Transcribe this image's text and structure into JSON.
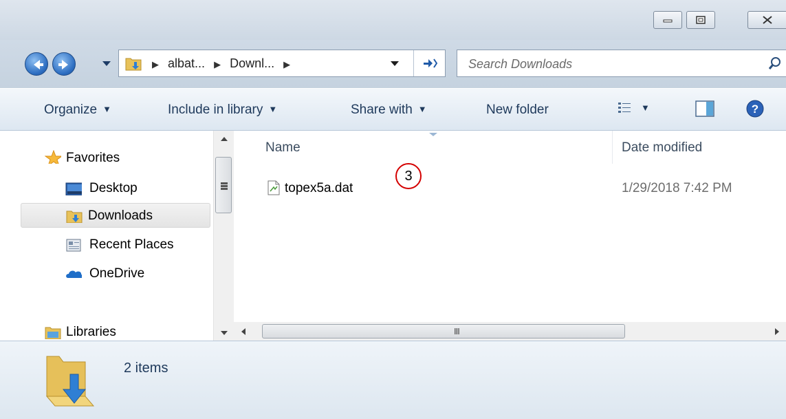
{
  "window": {
    "controls": {
      "minimize": "minimize",
      "maximize": "maximize",
      "close": "close"
    }
  },
  "address": {
    "breadcrumbs": [
      "albat...",
      "Downl..."
    ],
    "folder_icon": "downloads-folder-icon"
  },
  "search": {
    "placeholder": "Search Downloads",
    "value": ""
  },
  "toolbar": {
    "organize": "Organize",
    "include_in_library": "Include in library",
    "share_with": "Share with",
    "new_folder": "New folder",
    "views_icon": "view-options-icon",
    "preview_icon": "preview-pane-icon",
    "help_icon": "help-icon"
  },
  "nav": {
    "favorites": "Favorites",
    "items": [
      {
        "label": "Desktop",
        "icon": "desktop-icon"
      },
      {
        "label": "Downloads",
        "icon": "downloads-icon",
        "selected": true
      },
      {
        "label": "Recent Places",
        "icon": "recent-places-icon"
      },
      {
        "label": "OneDrive",
        "icon": "onedrive-icon"
      }
    ],
    "libraries": "Libraries"
  },
  "columns": {
    "name": "Name",
    "date_modified": "Date modified"
  },
  "files": [
    {
      "name": "topex5a.dat",
      "date_modified": "1/29/2018 7:42 PM",
      "icon": "data-file-icon"
    }
  ],
  "annotation": {
    "marker": "3"
  },
  "status": {
    "item_count": "2 items"
  },
  "colors": {
    "toolbar_text": "#1e395b",
    "marker_border": "#d40000",
    "accent_blue": "#2e6fc2"
  }
}
